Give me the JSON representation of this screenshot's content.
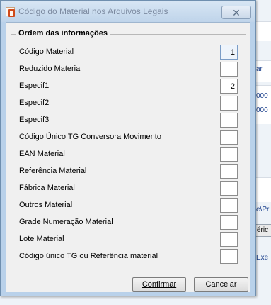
{
  "window": {
    "title": "Código do Material nos Arquivos Legais",
    "close_glyph": "✕"
  },
  "group": {
    "legend": "Ordem das informações"
  },
  "rows": [
    {
      "label": "Código Material",
      "value": "1"
    },
    {
      "label": "Reduzido Material",
      "value": ""
    },
    {
      "label": "Especif1",
      "value": "2"
    },
    {
      "label": "Especif2",
      "value": ""
    },
    {
      "label": "Especif3",
      "value": ""
    },
    {
      "label": "Código Único TG Conversora Movimento",
      "value": ""
    },
    {
      "label": "EAN Material",
      "value": ""
    },
    {
      "label": "Referência Material",
      "value": ""
    },
    {
      "label": "Fábrica Material",
      "value": ""
    },
    {
      "label": "Outros Material",
      "value": ""
    },
    {
      "label": "Grade Numeração Material",
      "value": ""
    },
    {
      "label": "Lote Material",
      "value": ""
    },
    {
      "label": "Código único TG ou Referência material",
      "value": ""
    }
  ],
  "buttons": {
    "confirm": "Confirmar",
    "cancel": "Cancelar"
  },
  "background": {
    "texts": [
      "ar",
      "000",
      "000",
      "e\\Pr",
      "éric",
      "Exe"
    ]
  }
}
